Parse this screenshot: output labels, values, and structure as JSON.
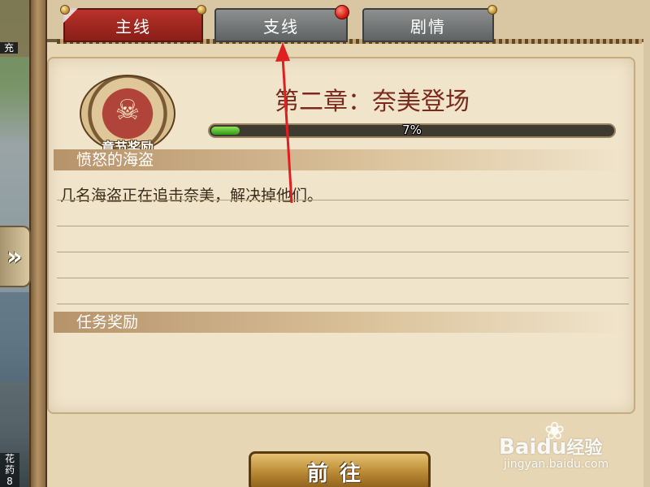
{
  "side": {
    "top_label": "充",
    "bottom_label": "花\n药\n8",
    "expand_icon": "double-chevron-right-icon"
  },
  "tabs": [
    {
      "label": "主线",
      "active": true
    },
    {
      "label": "支线",
      "active": false,
      "has_notification": true
    },
    {
      "label": "剧情",
      "active": false
    }
  ],
  "chapter": {
    "reward_label": "章节奖励",
    "reward_icon": "pirate-scroll-icon",
    "title": "第二章：奈美登场",
    "progress_text": "7%",
    "progress_value": 0.07
  },
  "quest": {
    "name": "愤怒的海盗",
    "description": "几名海盗正在追击奈美，解决掉他们。",
    "reward_header": "任务奖励"
  },
  "go_button": {
    "label": "前往"
  },
  "watermark": {
    "brand_latin": "Bai",
    "brand_mid": "du",
    "brand_cn": "经验",
    "url": "jingyan.baidu.com"
  },
  "colors": {
    "active_tab": "#b8322a",
    "inactive_tab": "#6f7272",
    "title": "#7a2a1c",
    "progress_fill": "#4cc22a",
    "annotation": "#e02020"
  }
}
